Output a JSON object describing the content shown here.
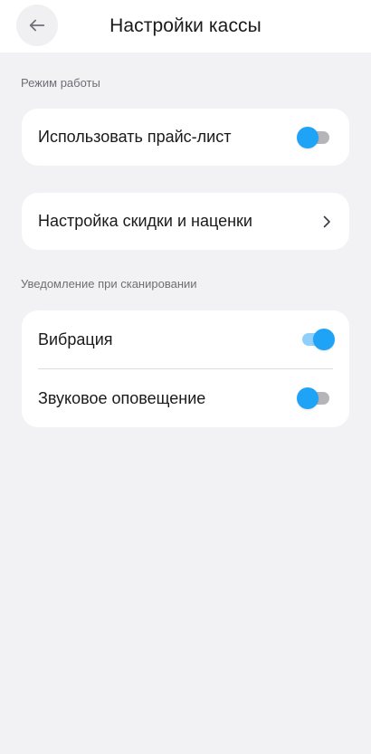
{
  "header": {
    "title": "Настройки кассы",
    "back_icon": "arrow-left-icon"
  },
  "sections": {
    "work_mode": {
      "label": "Режим работы",
      "price_list": {
        "label": "Использовать прайс-лист",
        "enabled": false
      }
    },
    "discount": {
      "label": "Настройка скидки и наценки",
      "icon": "chevron-right-icon"
    },
    "scan_notify": {
      "label": "Уведомление при сканировании",
      "vibration": {
        "label": "Вибрация",
        "enabled": true
      },
      "sound": {
        "label": "Звуковое оповещение",
        "enabled": false
      }
    }
  },
  "colors": {
    "accent": "#1fa3f6",
    "track_off": "#b5b5b9",
    "background": "#f2f2f5",
    "card": "#ffffff"
  }
}
